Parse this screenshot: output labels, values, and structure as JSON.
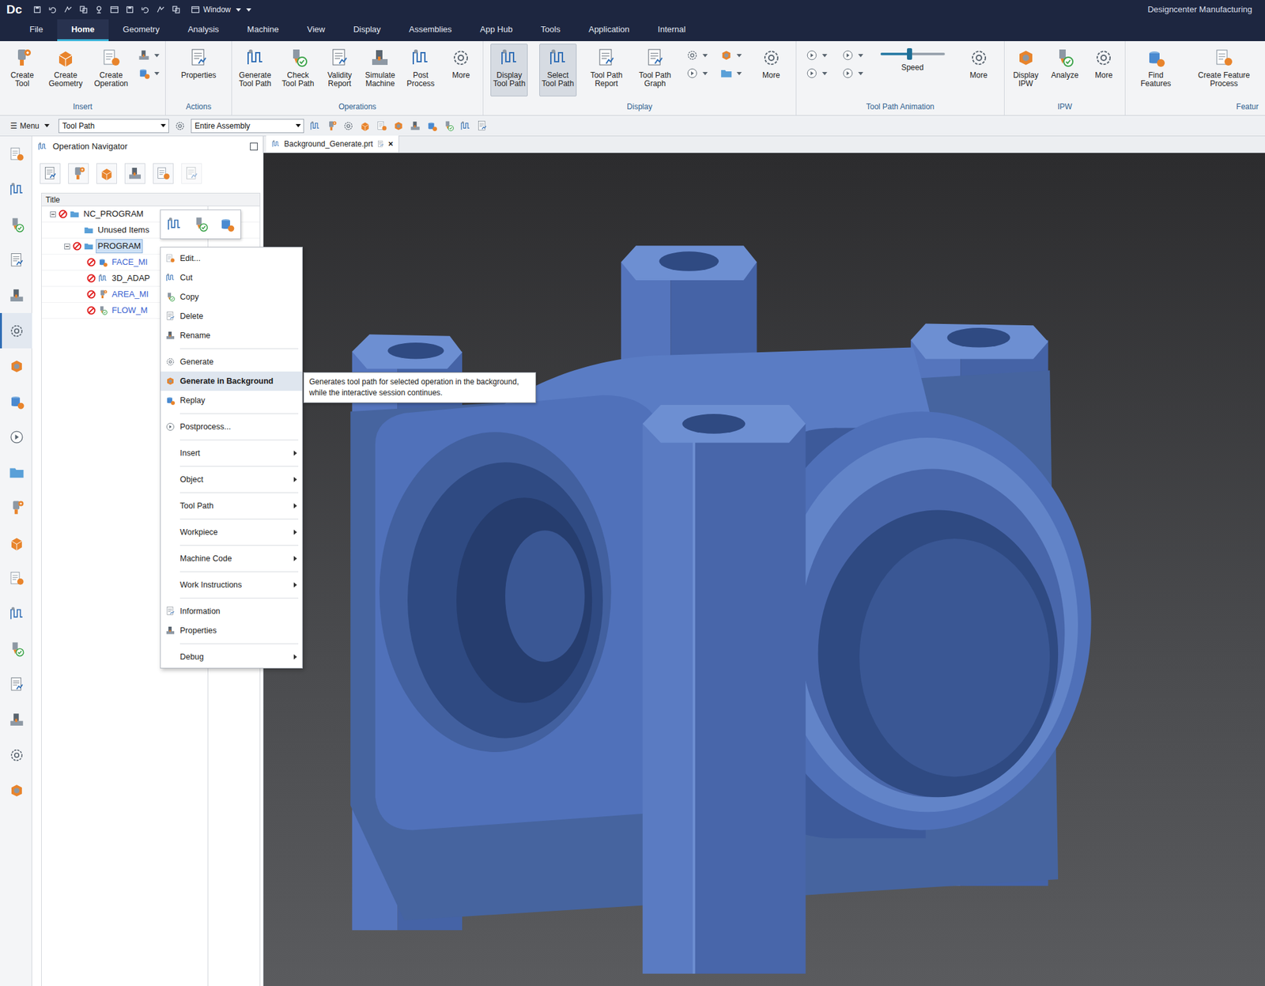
{
  "window": {
    "logo": "Dc",
    "window_menu": "Window",
    "title": "Designcenter Manufacturing"
  },
  "menu_tabs": [
    {
      "label": "File",
      "selected": false
    },
    {
      "label": "Home",
      "selected": true
    },
    {
      "label": "Geometry",
      "selected": false
    },
    {
      "label": "Analysis",
      "selected": false
    },
    {
      "label": "Machine",
      "selected": false
    },
    {
      "label": "View",
      "selected": false
    },
    {
      "label": "Display",
      "selected": false
    },
    {
      "label": "Assemblies",
      "selected": false
    },
    {
      "label": "App Hub",
      "selected": false
    },
    {
      "label": "Tools",
      "selected": false
    },
    {
      "label": "Application",
      "selected": false
    },
    {
      "label": "Internal",
      "selected": false
    }
  ],
  "ribbon": {
    "groups": [
      {
        "label": "Insert",
        "items": [
          {
            "kind": "large",
            "lines": [
              "Create",
              "Tool"
            ],
            "selected": false
          },
          {
            "kind": "large",
            "lines": [
              "Create",
              "Geometry"
            ],
            "selected": false
          },
          {
            "kind": "large",
            "lines": [
              "Create",
              "Operation"
            ],
            "selected": false
          },
          {
            "kind": "stack"
          }
        ]
      },
      {
        "label": "Actions",
        "items": [
          {
            "kind": "large",
            "lines": [
              "Properties"
            ],
            "selected": false
          }
        ]
      },
      {
        "label": "Operations",
        "items": [
          {
            "kind": "large",
            "lines": [
              "Generate",
              "Tool Path"
            ],
            "selected": false
          },
          {
            "kind": "large",
            "lines": [
              "Check",
              "Tool Path"
            ],
            "selected": false
          },
          {
            "kind": "large",
            "lines": [
              "Validity",
              "Report"
            ],
            "selected": false
          },
          {
            "kind": "large",
            "lines": [
              "Simulate",
              "Machine"
            ],
            "selected": false
          },
          {
            "kind": "large",
            "lines": [
              "Post",
              "Process"
            ],
            "selected": false
          },
          {
            "kind": "large",
            "lines": [
              "More"
            ],
            "selected": false
          }
        ]
      },
      {
        "label": "Display",
        "items": [
          {
            "kind": "large",
            "lines": [
              "Display",
              "Tool Path"
            ],
            "selected": true
          },
          {
            "kind": "large",
            "lines": [
              "Select",
              "Tool Path"
            ],
            "selected": true
          },
          {
            "kind": "large",
            "lines": [
              "Tool Path",
              "Report"
            ],
            "selected": false
          },
          {
            "kind": "large",
            "lines": [
              "Tool Path",
              "Graph"
            ],
            "selected": false
          },
          {
            "kind": "stack"
          },
          {
            "kind": "stack"
          },
          {
            "kind": "large",
            "lines": [
              "More"
            ],
            "selected": false
          }
        ]
      },
      {
        "label": "Tool Path Animation",
        "items": [
          {
            "kind": "stack"
          },
          {
            "kind": "stack"
          },
          {
            "kind": "slider",
            "label": "Speed",
            "level": 0.45
          },
          {
            "kind": "large",
            "lines": [
              "More"
            ],
            "selected": false
          }
        ]
      },
      {
        "label": "IPW",
        "items": [
          {
            "kind": "large",
            "lines": [
              "Display",
              "IPW"
            ],
            "selected": false
          },
          {
            "kind": "large",
            "lines": [
              "Analyze"
            ],
            "selected": false
          },
          {
            "kind": "large",
            "lines": [
              "More"
            ],
            "selected": false
          }
        ]
      },
      {
        "label": "Featur",
        "items": [
          {
            "kind": "large",
            "lines": [
              "Find",
              "Features"
            ],
            "selected": false
          },
          {
            "kind": "large",
            "lines": [
              "Create Feature",
              "Process"
            ],
            "selected": false
          }
        ]
      }
    ]
  },
  "toolbar": {
    "menu_icon": "☰",
    "menu": "Menu",
    "filter": "Tool Path",
    "scope": "Entire Assembly"
  },
  "sidebar": {
    "items": [
      {
        "selected": false
      },
      {
        "selected": false
      },
      {
        "selected": false
      },
      {
        "selected": false
      },
      {
        "selected": false
      },
      {
        "selected": true
      },
      {
        "selected": false
      },
      {
        "selected": false
      },
      {
        "selected": false
      },
      {
        "selected": false
      },
      {
        "selected": false
      },
      {
        "selected": false
      },
      {
        "selected": false
      },
      {
        "selected": false
      },
      {
        "selected": false
      },
      {
        "selected": false
      },
      {
        "selected": false
      },
      {
        "selected": false
      },
      {
        "selected": false
      }
    ]
  },
  "navigator": {
    "title": "Operation Navigator",
    "column": "Title",
    "rows": [
      {
        "label": "NC_PROGRAM",
        "depth": 0,
        "kind": "root",
        "expanded": true,
        "status": true,
        "selected": false,
        "color": "#1a1a1a"
      },
      {
        "label": "Unused Items",
        "depth": 1,
        "kind": "folder",
        "expanded": false,
        "status": false,
        "selected": false,
        "color": "#1a1a1a"
      },
      {
        "label": "PROGRAM",
        "depth": 1,
        "kind": "folder",
        "expanded": true,
        "status": true,
        "selected": true,
        "color": "#1a1a1a"
      },
      {
        "label": "FACE_MI",
        "depth": 2,
        "kind": "operation",
        "expanded": false,
        "status": true,
        "selected": false,
        "color": "#3a5fd0"
      },
      {
        "label": "3D_ADAP",
        "depth": 2,
        "kind": "operation",
        "expanded": false,
        "status": true,
        "selected": false,
        "color": "#1a1a1a"
      },
      {
        "label": "AREA_MI",
        "depth": 2,
        "kind": "operation",
        "expanded": false,
        "status": true,
        "selected": false,
        "color": "#3a5fd0"
      },
      {
        "label": "FLOW_M",
        "depth": 2,
        "kind": "operation",
        "expanded": false,
        "status": true,
        "selected": false,
        "color": "#3a5fd0"
      }
    ]
  },
  "document_tab": {
    "label": "Background_Generate.prt",
    "close": "×"
  },
  "context_menu": {
    "items": [
      {
        "label": "Edit...",
        "kind": "command",
        "highlighted": false
      },
      {
        "label": "Cut",
        "kind": "command",
        "highlighted": false
      },
      {
        "label": "Copy",
        "kind": "command",
        "highlighted": false
      },
      {
        "label": "Delete",
        "kind": "command",
        "highlighted": false
      },
      {
        "label": "Rename",
        "kind": "command",
        "highlighted": false
      },
      {
        "kind": "separator"
      },
      {
        "label": "Generate",
        "kind": "command",
        "highlighted": false
      },
      {
        "label": "Generate in Background",
        "kind": "command",
        "highlighted": true
      },
      {
        "label": "Replay",
        "kind": "command",
        "highlighted": false
      },
      {
        "kind": "separator"
      },
      {
        "label": "Postprocess...",
        "kind": "command",
        "highlighted": false
      },
      {
        "kind": "separator"
      },
      {
        "label": "Insert",
        "kind": "submenu",
        "highlighted": false
      },
      {
        "kind": "separator"
      },
      {
        "label": "Object",
        "kind": "submenu",
        "highlighted": false
      },
      {
        "kind": "separator"
      },
      {
        "label": "Tool Path",
        "kind": "submenu",
        "highlighted": false
      },
      {
        "kind": "separator"
      },
      {
        "label": "Workpiece",
        "kind": "submenu",
        "highlighted": false
      },
      {
        "kind": "separator"
      },
      {
        "label": "Machine Code",
        "kind": "submenu",
        "highlighted": false
      },
      {
        "kind": "separator"
      },
      {
        "label": "Work Instructions",
        "kind": "submenu",
        "highlighted": false
      },
      {
        "kind": "separator"
      },
      {
        "label": "Information",
        "kind": "command",
        "highlighted": false
      },
      {
        "label": "Properties",
        "kind": "command",
        "highlighted": false
      },
      {
        "kind": "separator"
      },
      {
        "label": "Debug",
        "kind": "submenu",
        "highlighted": false
      }
    ]
  },
  "tooltip": "Generates tool path for selected operation in the background, while the interactive session continues."
}
